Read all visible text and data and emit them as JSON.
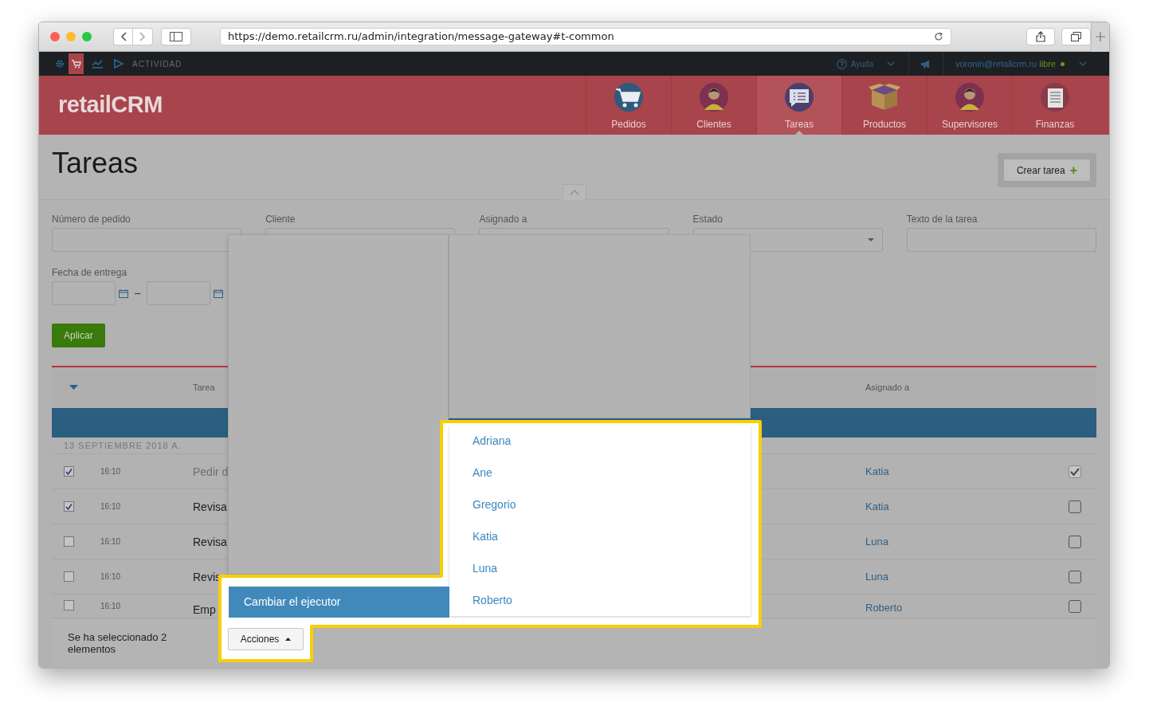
{
  "browser": {
    "url": "https://demo.retailcrm.ru/admin/integration/message-gateway#t-common"
  },
  "topbar": {
    "section": "ACTIVIDAD",
    "help": "Ayuda",
    "user": "voronin@retailcrm.ru",
    "user_status": "libre"
  },
  "logo": {
    "text": "retailCRM"
  },
  "nav": [
    {
      "label": "Pedidos",
      "kind": "cart",
      "selected": false
    },
    {
      "label": "Clientes",
      "kind": "person",
      "selected": false
    },
    {
      "label": "Tareas",
      "kind": "chat",
      "selected": true
    },
    {
      "label": "Productos",
      "kind": "box",
      "selected": false
    },
    {
      "label": "Supervisores",
      "kind": "person",
      "selected": false
    },
    {
      "label": "Finanzas",
      "kind": "ledger",
      "selected": false
    }
  ],
  "page": {
    "title": "Tareas",
    "create_button": "Crear tarea",
    "create_icon": "+"
  },
  "filters": [
    {
      "label": "Número de pedido",
      "kind": "text"
    },
    {
      "label": "Cliente",
      "kind": "text"
    },
    {
      "label": "Asignado a",
      "kind": "text"
    },
    {
      "label": "Estado",
      "kind": "select"
    },
    {
      "label": "Texto de la tarea",
      "kind": "text"
    }
  ],
  "date_filter": {
    "label": "Fecha de entrega",
    "separator": "–"
  },
  "apply_button": "Aplicar",
  "table": {
    "columns": [
      "Tarea",
      "Asignado a"
    ],
    "group": "13 SEPTIEMBRE 2018 A.",
    "rows": [
      {
        "selected": true,
        "time": "16:10",
        "task": "Pedir d",
        "assignee": "Katia",
        "done": true
      },
      {
        "selected": true,
        "time": "16:10",
        "task": "Revisa",
        "assignee": "Katia",
        "done": false
      },
      {
        "selected": false,
        "time": "16:10",
        "task": "Revisa",
        "assignee": "Luna",
        "done": false
      },
      {
        "selected": false,
        "time": "16:10",
        "task": "Revis",
        "assignee": "Luna",
        "done": false
      },
      {
        "selected": false,
        "time": "16:10",
        "task": "Emp",
        "assignee": "Roberto",
        "done": false
      }
    ]
  },
  "bulk": {
    "selection_text": "Se ha seleccionado 2 elementos",
    "actions_button": "Acciones",
    "menu_item": "Cambiar el ejecutor",
    "assignees": [
      "Adriana",
      "Ane",
      "Gregorio",
      "Katia",
      "Luna",
      "Roberto"
    ]
  }
}
